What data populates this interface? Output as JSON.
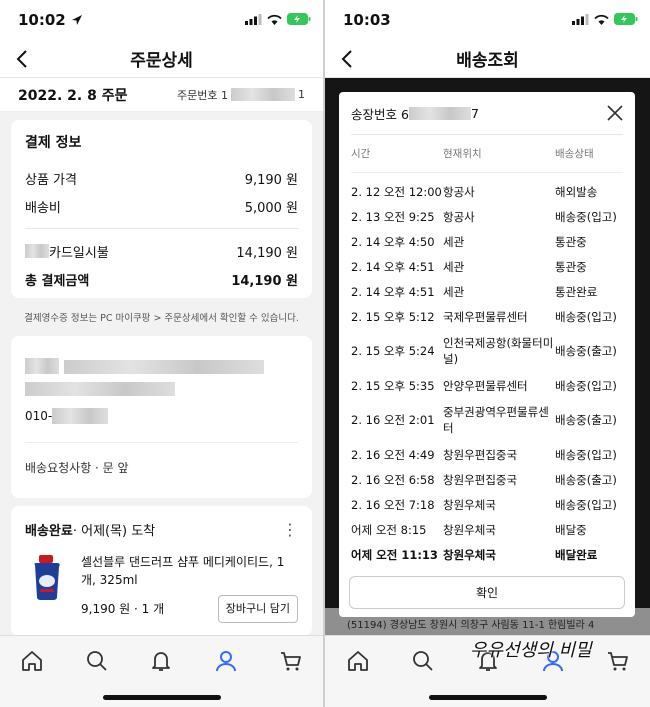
{
  "left": {
    "status_time": "10:02",
    "nav_title": "주문상세",
    "order_date": "2022. 2. 8 주문",
    "order_no_label": "주문번호 1",
    "order_no_tail": "1",
    "payment": {
      "title": "결제 정보",
      "product_label": "상품 가격",
      "product_value": "9,190 원",
      "shipping_label": "배송비",
      "shipping_value": "5,000 원",
      "card_label": "카드일시불",
      "card_value": "14,190 원",
      "total_label": "총 결제금액",
      "total_value": "14,190 원"
    },
    "receipt_note": "결제영수증 정보는 PC 마이쿠팡 > 주문상세에서 확인할 수 있습니다.",
    "address": {
      "phone_prefix": "010-",
      "request": "배송요청사항 · 문 앞"
    },
    "shipment": {
      "status": "배송완료",
      "arrival": " · 어제(목) 도착",
      "product_name": "셀선블루 댄드러프 샴푸 메디케이티드, 1개, 325ml",
      "price_qty": "9,190 원 · 1 개",
      "cart_button": "장바구니 담기"
    }
  },
  "right": {
    "status_time": "10:03",
    "nav_title": "배송조회",
    "invoice_label": "송장번호 6",
    "invoice_tail": "7",
    "columns": [
      "시간",
      "현재위치",
      "배송상태"
    ],
    "tracking": [
      {
        "time": "2. 12 오전 12:00",
        "loc": "항공사",
        "status": "해외발송"
      },
      {
        "time": "2. 13 오전 9:25",
        "loc": "항공사",
        "status": "배송중(입고)"
      },
      {
        "time": "2. 14 오후 4:50",
        "loc": "세관",
        "status": "통관중"
      },
      {
        "time": "2. 14 오후 4:51",
        "loc": "세관",
        "status": "통관중"
      },
      {
        "time": "2. 14 오후 4:51",
        "loc": "세관",
        "status": "통관완료"
      },
      {
        "time": "2. 15 오후 5:12",
        "loc": "국제우편물류센터",
        "status": "배송중(입고)"
      },
      {
        "time": "2. 15 오후 5:24",
        "loc": "인천국제공항(화물터미널)",
        "status": "배송중(출고)"
      },
      {
        "time": "2. 15 오후 5:35",
        "loc": "안양우편물류센터",
        "status": "배송중(입고)"
      },
      {
        "time": "2. 16 오전 2:01",
        "loc": "중부권광역우편물류센터",
        "status": "배송중(출고)"
      },
      {
        "time": "2. 16 오전 4:49",
        "loc": "창원우편집중국",
        "status": "배송중(입고)"
      },
      {
        "time": "2. 16 오전 6:58",
        "loc": "창원우편집중국",
        "status": "배송중(출고)"
      },
      {
        "time": "2. 16 오전 7:18",
        "loc": "창원우체국",
        "status": "배송중(입고)"
      },
      {
        "time": "어제 오전 8:15",
        "loc": "창원우체국",
        "status": "배달중"
      },
      {
        "time": "어제 오전 11:13",
        "loc": "창원우체국",
        "status": "배달완료"
      }
    ],
    "confirm_button": "확인",
    "behind_text": "(51194) 경상남도 창원시 의창구 사림동 11-1 한림빌라 4"
  },
  "watermark": "우유선생의 비밀",
  "colors": {
    "accent": "#346aff",
    "dim": "#151515"
  }
}
